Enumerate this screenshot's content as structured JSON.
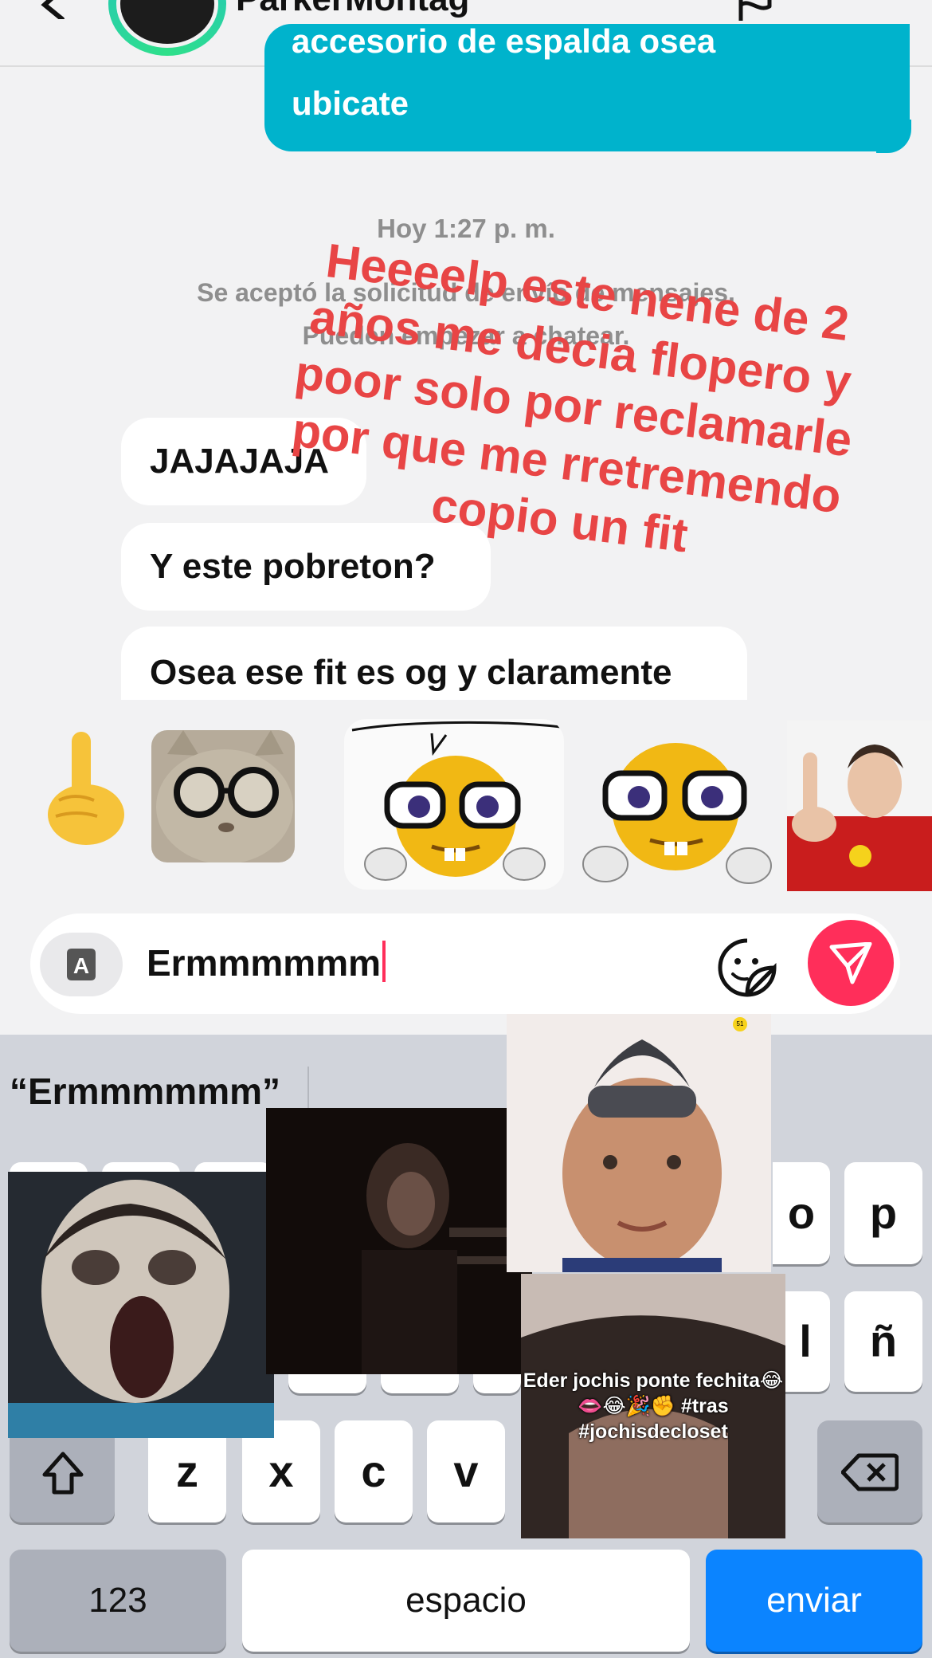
{
  "header": {
    "contact_name": "ParkerMontag"
  },
  "messages": {
    "outgoing_last_line_partial": "accesorio de espalda osea",
    "outgoing_last_line": "ubicate",
    "timestamp": "Hoy 1:27 p. m.",
    "system_line1": "Se aceptó la solicitud de envío de mensajes.",
    "system_line2": "Pueden empezar a chatear.",
    "incoming": [
      "JAJAJAJA",
      "Y este pobreton?",
      "Osea ese fit es og y claramente"
    ]
  },
  "overlay_caption": [
    "Heeeelp este nene de 2",
    "años me decia flopero y",
    "poor solo por reclamarle",
    "por que me rretremendo",
    "copio un fit"
  ],
  "composer": {
    "mode_button_label": "A",
    "input_value": "Ermmmmmm"
  },
  "keyboard": {
    "suggestion": "“Ermmmmmm”",
    "keys": {
      "o": "o",
      "p": "p",
      "l": "l",
      "ny": "ñ",
      "z": "z",
      "x": "x",
      "c": "c",
      "v": "v",
      "num": "123",
      "space": "espacio",
      "send": "enviar"
    }
  },
  "memes": {
    "caption_line1": "Eder jochis ponte fechita😂",
    "caption_line2": "👄😂🎉✊ #tras",
    "caption_line3": "#jochisdecloset",
    "badge": "51"
  },
  "colors": {
    "outgoing_bubble": "#00b3cc",
    "send_button": "#ff2e5a",
    "caption_red": "#e84545",
    "keyboard_send": "#0b84ff"
  }
}
